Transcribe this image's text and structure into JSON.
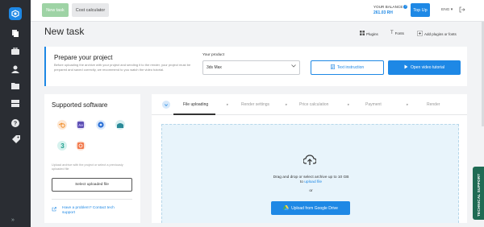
{
  "topbar": {
    "new_task_label": "New task",
    "cost_calculator_label": "Cost calculator",
    "balance_label": "YOUR BALANCE",
    "balance_help": "?",
    "balance_value": "261.03 RH",
    "topup_label": "Top Up",
    "language": "ENG",
    "language_chevron": "▾",
    "logout_icon": "logout-icon"
  },
  "sidebar": {
    "logo": "app-logo",
    "items": [
      {
        "icon": "copy-icon"
      },
      {
        "icon": "briefcase-icon"
      },
      {
        "icon": "user-icon"
      },
      {
        "icon": "folder-icon"
      },
      {
        "icon": "server-icon"
      },
      {
        "icon": "question-icon"
      },
      {
        "icon": "tag-icon"
      }
    ],
    "expand": "»"
  },
  "page": {
    "title": "New task",
    "links": [
      {
        "label": "Plugins",
        "icon": "grid-icon"
      },
      {
        "label": "Fonts",
        "icon": "font-icon"
      },
      {
        "label": "Add plugins or fonts",
        "icon": "add-icon"
      }
    ]
  },
  "prepare": {
    "title": "Prepare your project",
    "description": "Before uploading the archive with your project and sending it to the render, your project must be prepared and saved correctly, we recommend to you watch the video tutorial.",
    "product_label": "Your product",
    "product_value": "3ds Max",
    "text_instruction_label": "Text instruction",
    "video_tutorial_label": "Open video tutorial"
  },
  "software": {
    "title": "Supported software",
    "icons": [
      {
        "name": "blender-icon",
        "color": "#f5a05a"
      },
      {
        "name": "after-effects-icon",
        "color": "#9a8fd1"
      },
      {
        "name": "cinema4d-icon",
        "color": "#5aa0e8"
      },
      {
        "name": "houdini-icon",
        "color": "#3c9aa8"
      },
      {
        "name": "3dsmax-icon",
        "color": "#39b9a8"
      },
      {
        "name": "corona-icon",
        "color": "#f58a5a"
      }
    ],
    "note": "Upload archive with the project or select a previously uploaded file",
    "select_file_label": "Select uploaded file",
    "help_link": "Have a problem? Contact tech support"
  },
  "steps": [
    {
      "label": "File uploading",
      "active": true
    },
    {
      "label": "Render settings",
      "active": false
    },
    {
      "label": "Price calculation",
      "active": false
    },
    {
      "label": "Payment",
      "active": false
    },
    {
      "label": "Render",
      "active": false
    }
  ],
  "upload": {
    "drop_text": "Drag and drop or select archive up to 10 GB",
    "drop_to": "to",
    "upload_file_link": "upload file",
    "or_text": "or",
    "gdrive_label": "Upload from Google Drive"
  },
  "support_tab": "TECHNICAL SUPPORT",
  "colors": {
    "accent": "#1e88e5",
    "new_task_btn": "#9ed3a5",
    "sidebar": "#2a2d33",
    "support_tab": "#1f6b54"
  }
}
